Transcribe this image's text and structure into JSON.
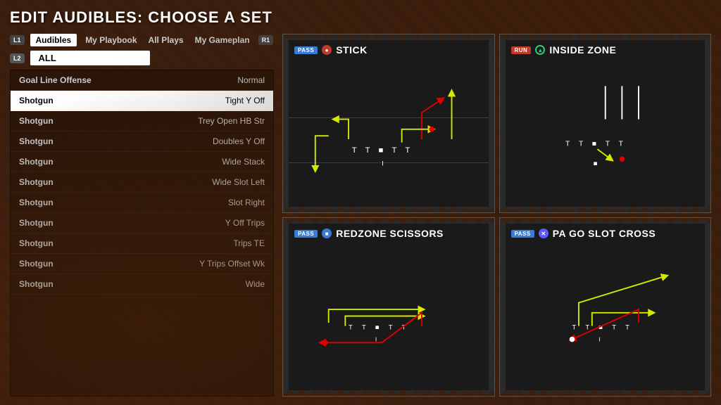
{
  "title": "EDIT AUDIBLES: CHOOSE A SET",
  "tabs": {
    "l1_badge": "L1",
    "r1_badge": "R1",
    "items": [
      {
        "label": "Audibles",
        "active": true
      },
      {
        "label": "My Playbook",
        "active": false
      },
      {
        "label": "All Plays",
        "active": false
      },
      {
        "label": "My Gameplan",
        "active": false
      }
    ]
  },
  "filter": {
    "l2_badge": "L2",
    "value": "ALL"
  },
  "play_list": [
    {
      "left": "Goal Line Offense",
      "right": "Normal",
      "selected": false
    },
    {
      "left": "Shotgun",
      "right": "Tight Y Off",
      "selected": true
    },
    {
      "left": "Shotgun",
      "right": "Trey Open HB Str",
      "selected": false
    },
    {
      "left": "Shotgun",
      "right": "Doubles Y Off",
      "selected": false
    },
    {
      "left": "Shotgun",
      "right": "Wide Stack",
      "selected": false
    },
    {
      "left": "Shotgun",
      "right": "Wide Slot Left",
      "selected": false
    },
    {
      "left": "Shotgun",
      "right": "Slot Right",
      "selected": false
    },
    {
      "left": "Shotgun",
      "right": "Y Off Trips",
      "selected": false
    },
    {
      "left": "Shotgun",
      "right": "Trips TE",
      "selected": false
    },
    {
      "left": "Shotgun",
      "right": "Y Trips Offset Wk",
      "selected": false
    },
    {
      "left": "Shotgun",
      "right": "Wide",
      "selected": false
    }
  ],
  "play_cards": [
    {
      "id": "card1",
      "type": "PASS",
      "type_class": "pass-badge",
      "button": "circle",
      "button_symbol": "●",
      "button_color": "circle-btn",
      "name": "STICK",
      "diagram_type": "stick"
    },
    {
      "id": "card2",
      "type": "RUN",
      "type_class": "run-badge",
      "button": "triangle",
      "button_symbol": "▲",
      "button_color": "triangle-btn",
      "name": "INSIDE ZONE",
      "diagram_type": "inside_zone"
    },
    {
      "id": "card3",
      "type": "PASS",
      "type_class": "pass-badge",
      "button": "square",
      "button_symbol": "■",
      "button_color": "square-btn",
      "name": "REDZONE SCISSORS",
      "diagram_type": "redzone_scissors"
    },
    {
      "id": "card4",
      "type": "PASS",
      "type_class": "pass-badge",
      "button": "x",
      "button_symbol": "✕",
      "button_color": "x-btn",
      "name": "PA GO SLOT CROSS",
      "diagram_type": "pa_go_slot_cross"
    }
  ]
}
